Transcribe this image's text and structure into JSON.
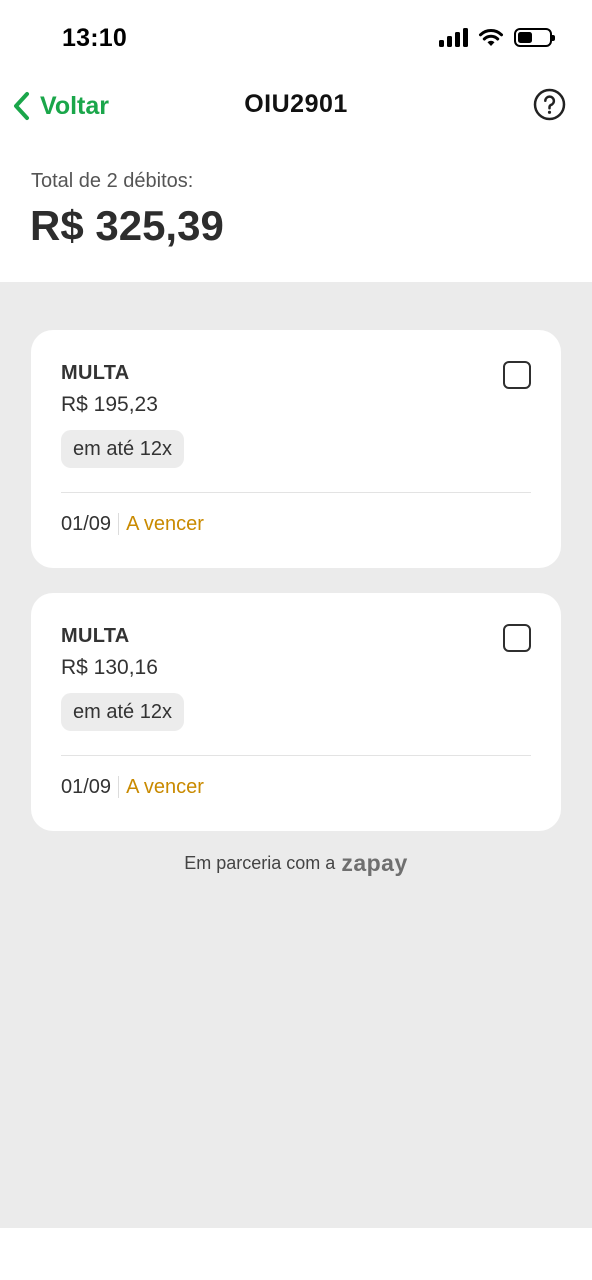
{
  "status_bar": {
    "time": "13:10"
  },
  "nav": {
    "back_label": "Voltar",
    "title": "OIU2901"
  },
  "summary": {
    "label": "Total de 2 débitos:",
    "total": "R$ 325,39"
  },
  "debits": [
    {
      "type": "MULTA",
      "amount": "R$ 195,23",
      "installments": "em até 12x",
      "due_date": "01/09",
      "status": "A vencer",
      "checked": false
    },
    {
      "type": "MULTA",
      "amount": "R$ 130,16",
      "installments": "em até 12x",
      "due_date": "01/09",
      "status": "A vencer",
      "checked": false
    }
  ],
  "footer": {
    "partner_text": "Em parceria com a",
    "partner_logo": "zapay"
  },
  "colors": {
    "accent": "#1aa64a",
    "status_pending": "#c98a00",
    "background": "#ebebeb"
  }
}
